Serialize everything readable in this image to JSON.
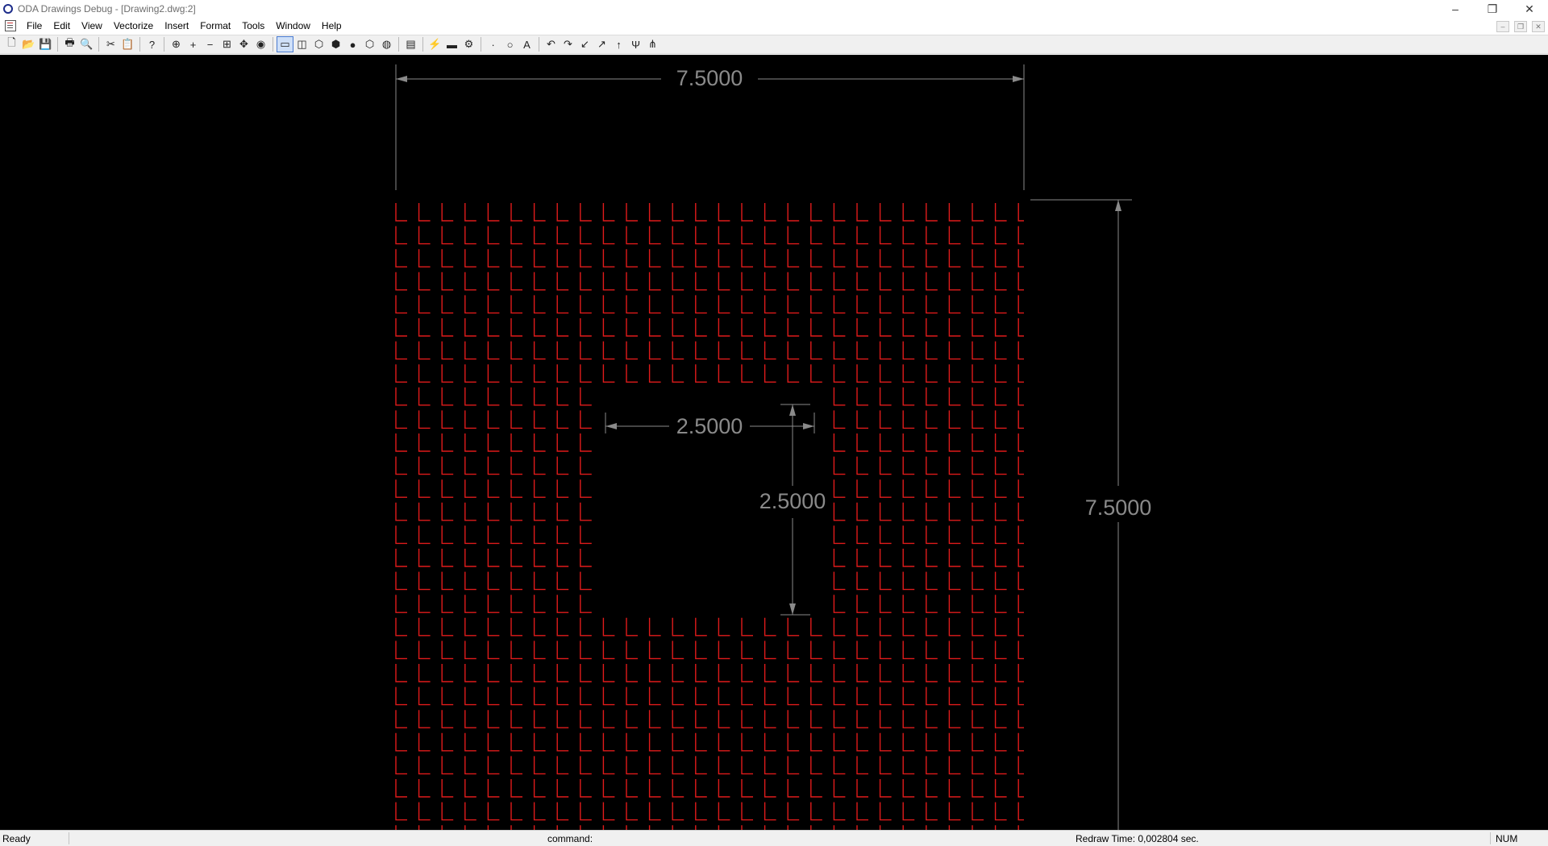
{
  "window": {
    "title": "ODA Drawings Debug - [Drawing2.dwg:2]",
    "controls": [
      "–",
      "❐",
      "✕"
    ]
  },
  "menu": {
    "items": [
      "File",
      "Edit",
      "View",
      "Vectorize",
      "Insert",
      "Format",
      "Tools",
      "Window",
      "Help"
    ],
    "mdi_controls": [
      "–",
      "❐",
      "✕"
    ]
  },
  "toolbar": {
    "buttons": [
      {
        "name": "new-icon",
        "glyph": "🗋"
      },
      {
        "name": "open-icon",
        "glyph": "📂"
      },
      {
        "name": "save-icon",
        "glyph": "💾"
      },
      {
        "sep": true
      },
      {
        "name": "print-icon",
        "glyph": "🖶"
      },
      {
        "name": "print-preview-icon",
        "glyph": "🔍"
      },
      {
        "sep": true
      },
      {
        "name": "cut-icon",
        "glyph": "✂"
      },
      {
        "name": "paste-icon",
        "glyph": "📋"
      },
      {
        "sep": true
      },
      {
        "name": "help-icon",
        "glyph": "?"
      },
      {
        "sep": true
      },
      {
        "name": "zoom-window-icon",
        "glyph": "⊕"
      },
      {
        "name": "zoom-in-icon",
        "glyph": "+"
      },
      {
        "name": "zoom-out-icon",
        "glyph": "−"
      },
      {
        "name": "zoom-extents-icon",
        "glyph": "⊞"
      },
      {
        "name": "pan-icon",
        "glyph": "✥"
      },
      {
        "name": "orbit-icon",
        "glyph": "◉"
      },
      {
        "sep": true
      },
      {
        "name": "wireframe-2d-icon",
        "glyph": "▭",
        "active": true
      },
      {
        "name": "hidden-line-icon",
        "glyph": "◫"
      },
      {
        "name": "wireframe-3d-icon",
        "glyph": "⬡"
      },
      {
        "name": "flat-shaded-icon",
        "glyph": "⬢"
      },
      {
        "name": "gouraud-shaded-icon",
        "glyph": "●"
      },
      {
        "name": "flat-edges-icon",
        "glyph": "⬡"
      },
      {
        "name": "gouraud-edges-icon",
        "glyph": "◍"
      },
      {
        "sep": true
      },
      {
        "name": "properties-icon",
        "glyph": "▤"
      },
      {
        "sep": true
      },
      {
        "name": "regen-icon",
        "glyph": "⚡"
      },
      {
        "name": "layer-icon",
        "glyph": "▬"
      },
      {
        "name": "settings-icon",
        "glyph": "⚙"
      },
      {
        "sep": true
      },
      {
        "name": "point-icon",
        "glyph": "∙"
      },
      {
        "name": "circle-icon",
        "glyph": "○"
      },
      {
        "name": "text-icon",
        "glyph": "A"
      },
      {
        "sep": true
      },
      {
        "name": "undo-icon",
        "glyph": "↶"
      },
      {
        "name": "redo-icon",
        "glyph": "↷"
      },
      {
        "name": "arrow-down-left-icon",
        "glyph": "↙"
      },
      {
        "name": "arrow-up-right-icon",
        "glyph": "↗"
      },
      {
        "name": "arrow-up-icon",
        "glyph": "↑"
      },
      {
        "name": "fork-icon",
        "glyph": "Ψ"
      },
      {
        "name": "tree-icon",
        "glyph": "⋔"
      }
    ]
  },
  "drawing": {
    "background": "#000000",
    "hatch_color": "#e01b1b",
    "dimension_color": "#8a8a8a",
    "dimensions": {
      "outer_width": "7.5000",
      "outer_height": "7.5000",
      "inner_width": "2.5000",
      "inner_height": "2.5000"
    }
  },
  "status": {
    "ready": "Ready",
    "command": "command:",
    "redraw_time": "Redraw Time: 0,002804 sec.",
    "num": "NUM"
  }
}
